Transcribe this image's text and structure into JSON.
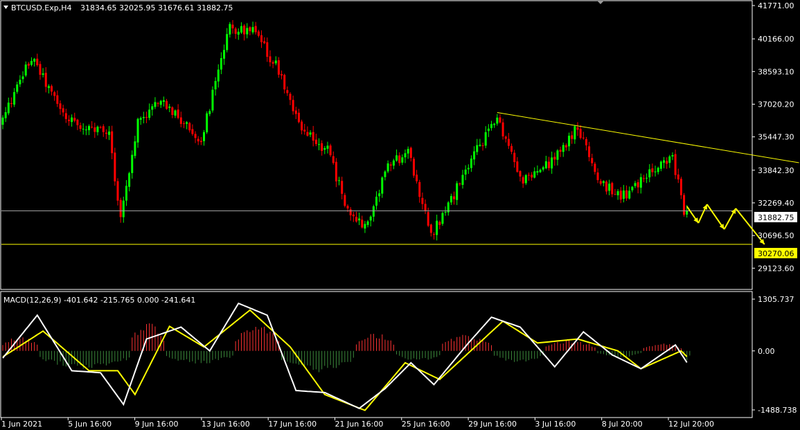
{
  "window": {
    "symbol_header": "BTCUSD.Exp,H4",
    "ohlc_header": "31834.65 32025.95 31676.61 31882.75",
    "indicator_header": "MACD(12,26,9) -401.642 -215.765 0.000 -241.641"
  },
  "colors": {
    "background": "#000000",
    "bull_candle": "#00ff00",
    "bear_candle": "#ff0000",
    "trendline": "#ffff00",
    "arrow": "#ffff00",
    "macd_line": "#ffffff",
    "signal_line": "#ffff00",
    "hist_positive": "#ff3333",
    "hist_negative": "#3c8a3c",
    "price_line": "#a0a0a0",
    "support_label_bg": "#ffff00",
    "price_label_bg": "#ffffff"
  },
  "icons": {
    "header_toggle": "triangle-down-icon",
    "panel_marker": "triangle-down-icon"
  },
  "chart_data": [
    {
      "type": "candlestick",
      "title": "BTCUSD.Exp,H4",
      "ylim": [
        28700,
        41771
      ],
      "y_ticks": [
        "41771.00",
        "40166.00",
        "38593.10",
        "37020.20",
        "35447.30",
        "33842.30",
        "32269.40",
        "30696.50",
        "29123.60"
      ],
      "x_ticks": [
        "1 Jun 2021",
        "5 Jun 16:00",
        "9 Jun 16:00",
        "13 Jun 16:00",
        "17 Jun 16:00",
        "21 Jun 16:00",
        "25 Jun 16:00",
        "29 Jun 16:00",
        "3 Jul 16:00",
        "8 Jul 20:00",
        "12 Jul 20:00"
      ],
      "candle_count": 239,
      "current_price_label": "31882.75",
      "current_price": 31882.75,
      "support_label": "30270.06",
      "support_price": 30270.06,
      "trendline": {
        "start": {
          "bar": 172,
          "price": 36620
        },
        "end": {
          "bar": 277,
          "price": 34200
        }
      },
      "key_points": [
        {
          "bar": 0,
          "price": 36000
        },
        {
          "bar": 11,
          "price": 39300
        },
        {
          "bar": 22,
          "price": 36500
        },
        {
          "bar": 31,
          "price": 35800
        },
        {
          "bar": 38,
          "price": 35600
        },
        {
          "bar": 42,
          "price": 31500
        },
        {
          "bar": 48,
          "price": 36200
        },
        {
          "bar": 56,
          "price": 37200
        },
        {
          "bar": 70,
          "price": 35300
        },
        {
          "bar": 80,
          "price": 40700
        },
        {
          "bar": 88,
          "price": 40500
        },
        {
          "bar": 97,
          "price": 38700
        },
        {
          "bar": 105,
          "price": 35700
        },
        {
          "bar": 114,
          "price": 34800
        },
        {
          "bar": 122,
          "price": 31500
        },
        {
          "bar": 128,
          "price": 31200
        },
        {
          "bar": 134,
          "price": 33800
        },
        {
          "bar": 142,
          "price": 34800
        },
        {
          "bar": 150,
          "price": 30700
        },
        {
          "bar": 158,
          "price": 32700
        },
        {
          "bar": 166,
          "price": 34800
        },
        {
          "bar": 173,
          "price": 36400
        },
        {
          "bar": 182,
          "price": 33300
        },
        {
          "bar": 192,
          "price": 34200
        },
        {
          "bar": 201,
          "price": 35900
        },
        {
          "bar": 208,
          "price": 33400
        },
        {
          "bar": 216,
          "price": 32500
        },
        {
          "bar": 226,
          "price": 33700
        },
        {
          "bar": 234,
          "price": 34400
        },
        {
          "bar": 238,
          "price": 31882.75
        }
      ],
      "forecast_arrow_path": [
        {
          "bar": 238,
          "price": 32100
        },
        {
          "bar": 242,
          "price": 31300
        },
        {
          "bar": 245,
          "price": 32200
        },
        {
          "bar": 251,
          "price": 31000
        },
        {
          "bar": 255,
          "price": 32000
        },
        {
          "bar": 265,
          "price": 30270.06
        }
      ]
    },
    {
      "type": "macd",
      "title": "MACD(12,26,9)",
      "ylim": [
        -1488.738,
        1305.737
      ],
      "y_ticks": [
        "1305.737",
        "0.00",
        "-1488.738"
      ],
      "macd_points": [
        {
          "bar": 0,
          "value": -180
        },
        {
          "bar": 12,
          "value": 900
        },
        {
          "bar": 24,
          "value": -500
        },
        {
          "bar": 34,
          "value": -550
        },
        {
          "bar": 42,
          "value": -1350
        },
        {
          "bar": 50,
          "value": 300
        },
        {
          "bar": 62,
          "value": 600
        },
        {
          "bar": 72,
          "value": 0
        },
        {
          "bar": 82,
          "value": 1200
        },
        {
          "bar": 92,
          "value": 900
        },
        {
          "bar": 102,
          "value": -1000
        },
        {
          "bar": 112,
          "value": -1050
        },
        {
          "bar": 124,
          "value": -1450
        },
        {
          "bar": 133,
          "value": -950
        },
        {
          "bar": 142,
          "value": -300
        },
        {
          "bar": 150,
          "value": -850
        },
        {
          "bar": 162,
          "value": 200
        },
        {
          "bar": 170,
          "value": 850
        },
        {
          "bar": 180,
          "value": 600
        },
        {
          "bar": 192,
          "value": -400
        },
        {
          "bar": 202,
          "value": 480
        },
        {
          "bar": 212,
          "value": -100
        },
        {
          "bar": 222,
          "value": -450
        },
        {
          "bar": 234,
          "value": 150
        },
        {
          "bar": 239,
          "value": -402
        }
      ],
      "signal_points": [
        {
          "bar": 0,
          "value": -150
        },
        {
          "bar": 14,
          "value": 500
        },
        {
          "bar": 30,
          "value": -500
        },
        {
          "bar": 40,
          "value": -500
        },
        {
          "bar": 46,
          "value": -1100
        },
        {
          "bar": 58,
          "value": 620
        },
        {
          "bar": 70,
          "value": 100
        },
        {
          "bar": 86,
          "value": 1030
        },
        {
          "bar": 100,
          "value": 100
        },
        {
          "bar": 112,
          "value": -1100
        },
        {
          "bar": 126,
          "value": -1500
        },
        {
          "bar": 140,
          "value": -300
        },
        {
          "bar": 152,
          "value": -720
        },
        {
          "bar": 174,
          "value": 750
        },
        {
          "bar": 186,
          "value": 200
        },
        {
          "bar": 200,
          "value": 300
        },
        {
          "bar": 214,
          "value": 0
        },
        {
          "bar": 222,
          "value": -450
        },
        {
          "bar": 236,
          "value": 0
        },
        {
          "bar": 239,
          "value": -216
        }
      ],
      "histogram_sign_segments": [
        {
          "from": 0,
          "to": 12,
          "value": 350
        },
        {
          "from": 13,
          "to": 44,
          "value": -420
        },
        {
          "from": 45,
          "to": 56,
          "value": 700
        },
        {
          "from": 57,
          "to": 80,
          "value": -300
        },
        {
          "from": 81,
          "to": 96,
          "value": 600
        },
        {
          "from": 97,
          "to": 122,
          "value": -500
        },
        {
          "from": 123,
          "to": 136,
          "value": 420
        },
        {
          "from": 137,
          "to": 152,
          "value": -250
        },
        {
          "from": 153,
          "to": 170,
          "value": 380
        },
        {
          "from": 171,
          "to": 188,
          "value": -280
        },
        {
          "from": 189,
          "to": 206,
          "value": 250
        },
        {
          "from": 207,
          "to": 222,
          "value": -150
        },
        {
          "from": 223,
          "to": 236,
          "value": 180
        },
        {
          "from": 237,
          "to": 239,
          "value": -242
        }
      ]
    }
  ]
}
